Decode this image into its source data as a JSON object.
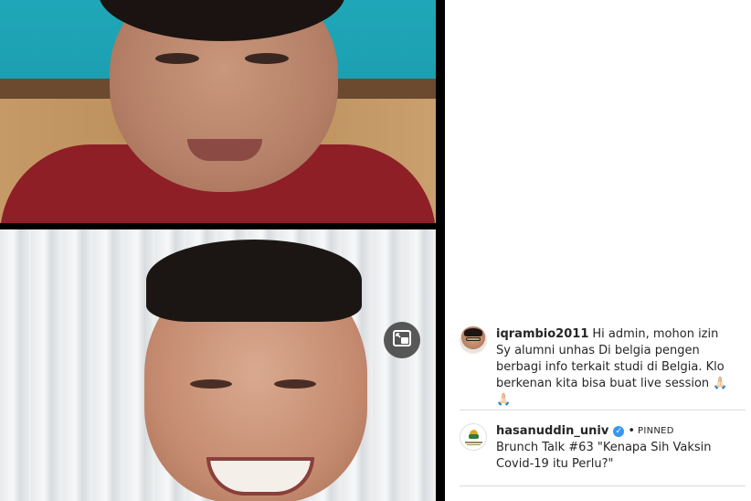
{
  "comments": [
    {
      "username": "iqrambio2011",
      "text": "Hi admin, mohon izin Sy alumni unhas Di belgia pengen berbagi info terkait studi di Belgia. Klo berkenan kita bisa buat live session",
      "emoji": "🙏🏻🙏🏻"
    },
    {
      "username": "hasanuddin_univ",
      "verified": true,
      "pinned_label": "PINNED",
      "separator_dot": "•",
      "text": "Brunch Talk #63 \"Kenapa Sih Vaksin Covid-19 itu Perlu?\""
    }
  ],
  "icons": {
    "pip": "picture-in-picture-icon",
    "verified": "verified-badge-icon"
  },
  "colors": {
    "verified_blue": "#3897f0",
    "divider": "#dbdbdb",
    "text": "#262626"
  }
}
